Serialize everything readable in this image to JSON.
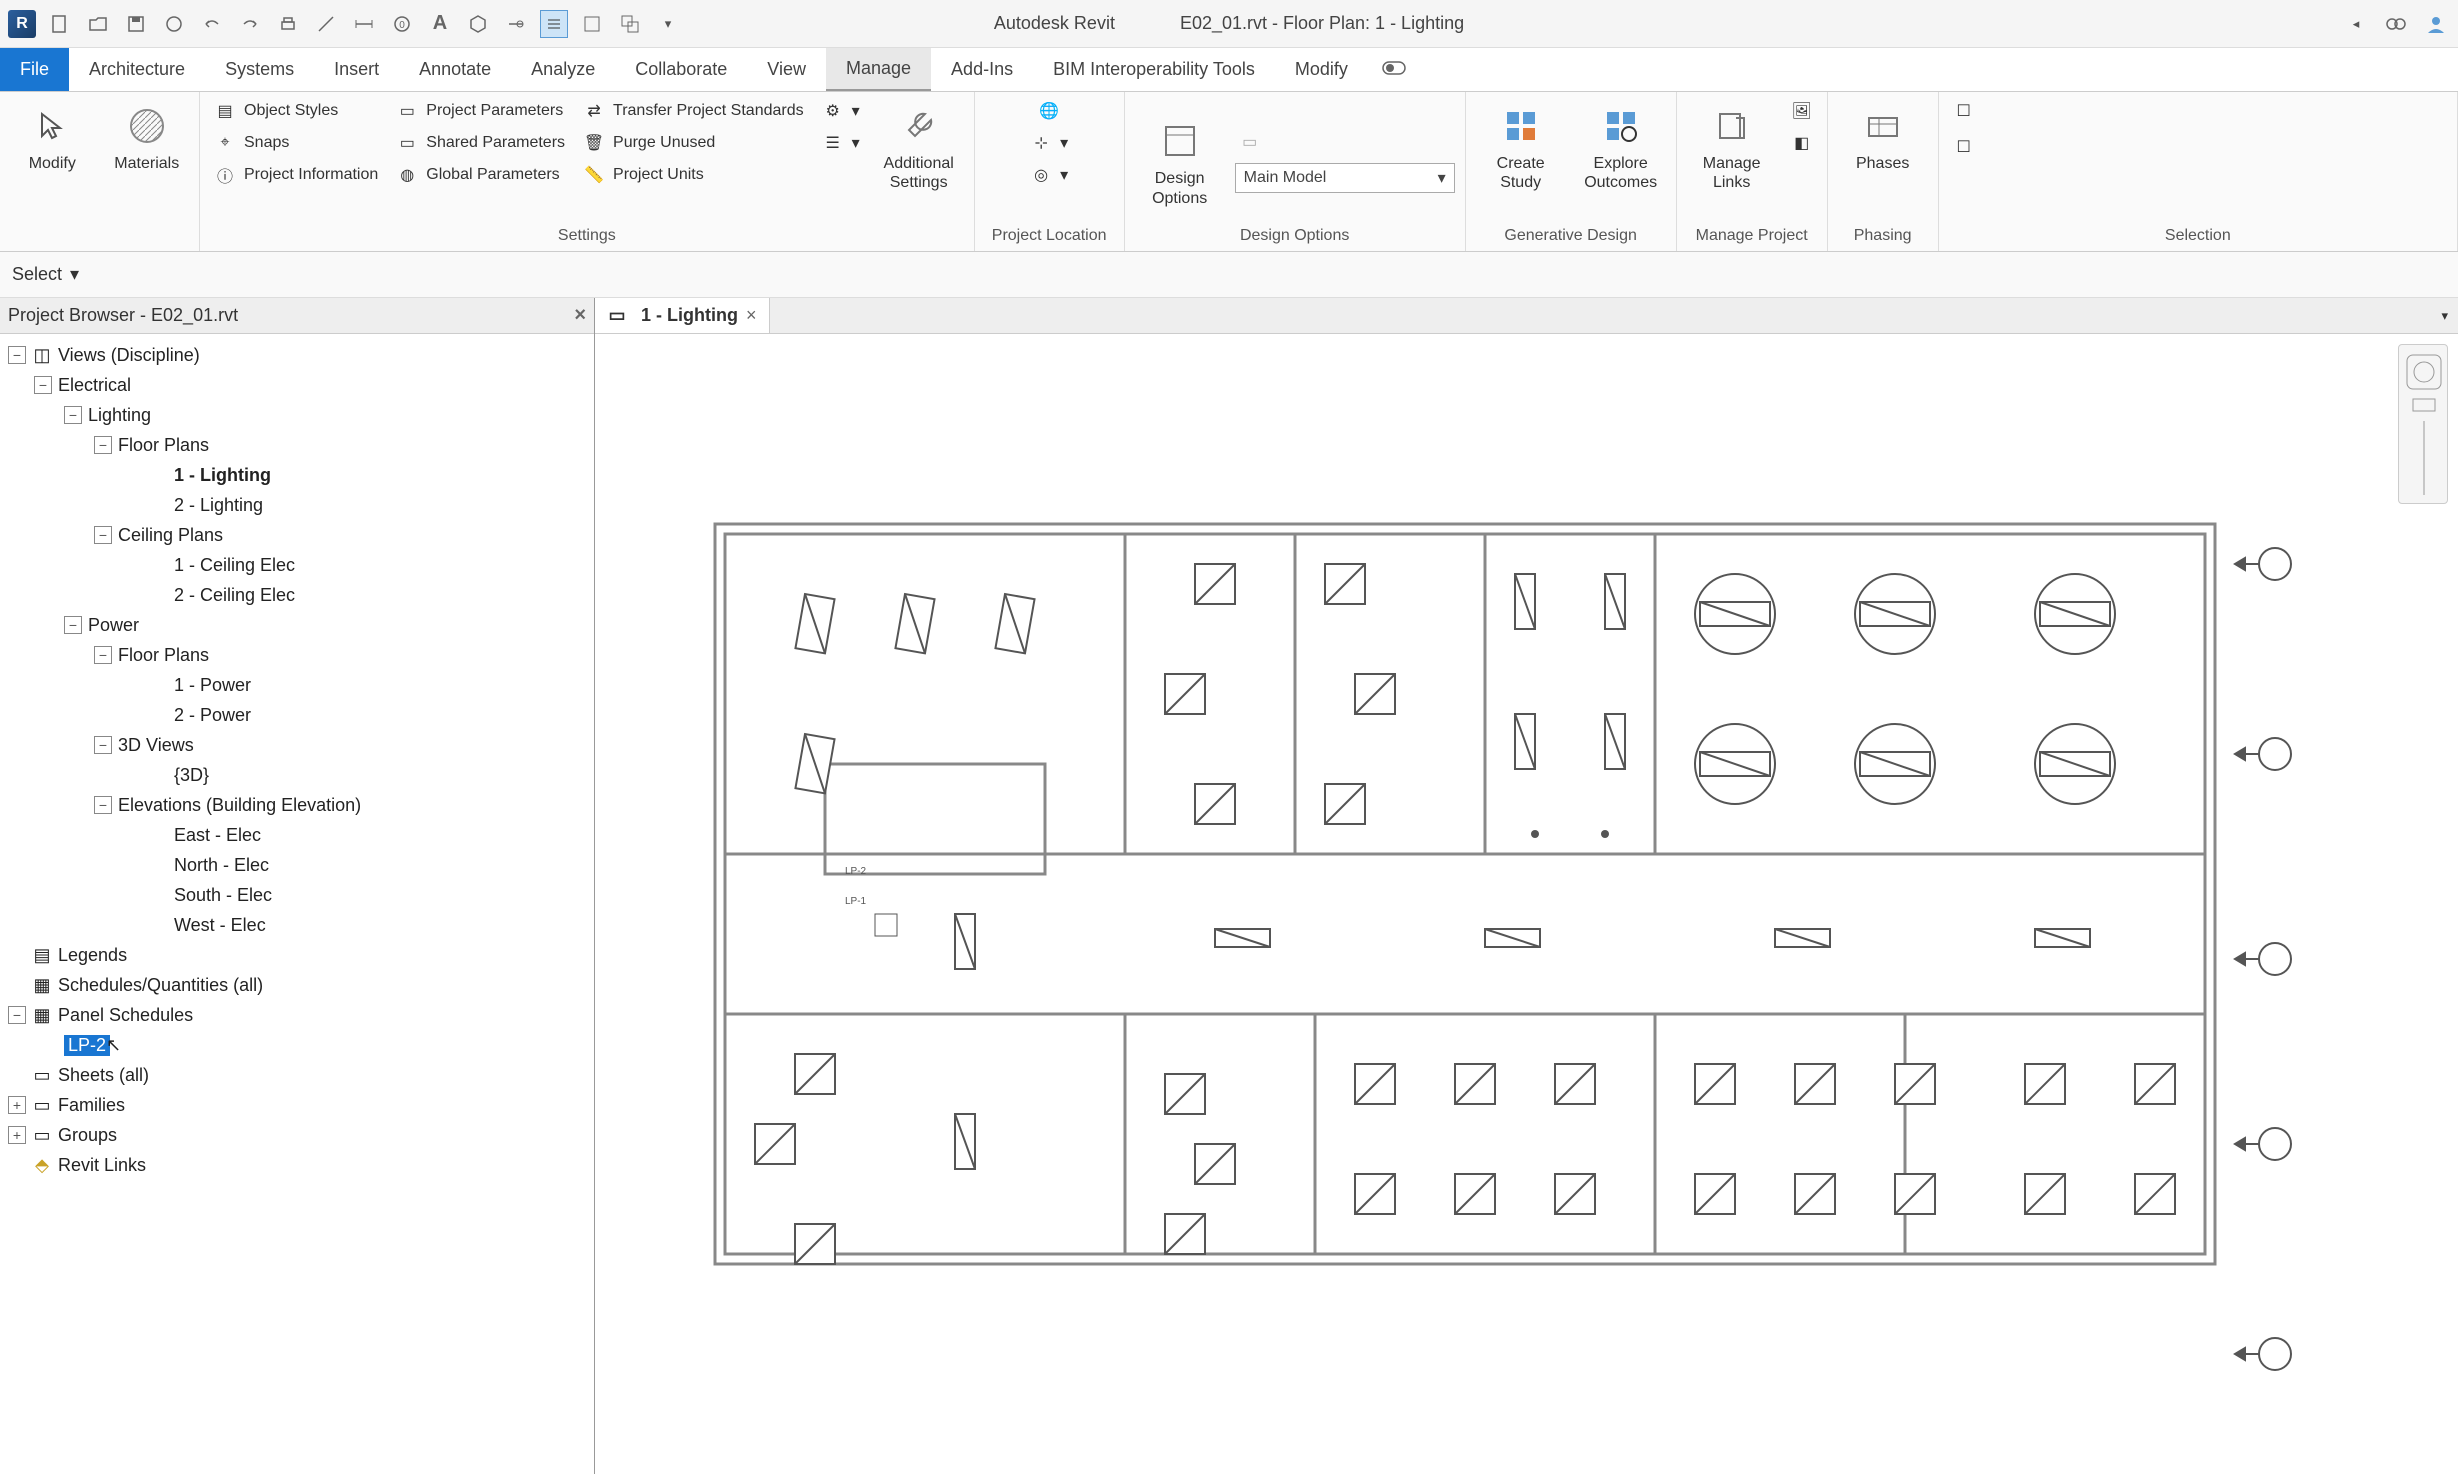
{
  "title_bar": {
    "app_name": "Autodesk Revit",
    "doc_title": "E02_01.rvt - Floor Plan: 1 - Lighting",
    "separator": " - "
  },
  "ribbon_tabs": {
    "file": "File",
    "architecture": "Architecture",
    "systems": "Systems",
    "insert": "Insert",
    "annotate": "Annotate",
    "analyze": "Analyze",
    "collaborate": "Collaborate",
    "view": "View",
    "manage": "Manage",
    "addins": "Add-Ins",
    "bim": "BIM Interoperability Tools",
    "modify": "Modify"
  },
  "ribbon": {
    "select_panel": {
      "select": "Select",
      "modify": "Modify",
      "materials": "Materials"
    },
    "settings_panel": {
      "label": "Settings",
      "object_styles": "Object  Styles",
      "snaps": "Snaps",
      "project_information": "Project  Information",
      "project_parameters": "Project  Parameters",
      "shared_parameters": "Shared  Parameters",
      "global_parameters": "Global  Parameters",
      "transfer_project_standards": "Transfer  Project Standards",
      "purge_unused": "Purge  Unused",
      "project_units": "Project  Units",
      "additional_settings": "Additional\nSettings"
    },
    "project_location_panel": {
      "label": "Project Location"
    },
    "design_options_panel": {
      "label": "Design Options",
      "design_options": "Design\nOptions",
      "combo_value": "Main Model"
    },
    "generative_design_panel": {
      "label": "Generative Design",
      "create_study": "Create\nStudy",
      "explore_outcomes": "Explore\nOutcomes"
    },
    "manage_project_panel": {
      "label": "Manage Project",
      "manage_links": "Manage\nLinks"
    },
    "phasing_panel": {
      "label": "Phasing",
      "phases": "Phases"
    },
    "selection_panel": {
      "label": "Selection"
    }
  },
  "project_browser": {
    "title": "Project Browser - E02_01.rvt",
    "views_root": "Views (Discipline)",
    "electrical": "Electrical",
    "lighting": "Lighting",
    "floor_plans": "Floor Plans",
    "fp_1_lighting": "1 - Lighting",
    "fp_2_lighting": "2 - Lighting",
    "ceiling_plans": "Ceiling Plans",
    "cp_1": "1 - Ceiling Elec",
    "cp_2": "2 - Ceiling Elec",
    "power": "Power",
    "fp_1_power": "1 - Power",
    "fp_2_power": "2 - Power",
    "views_3d": "3D Views",
    "view_3d": "{3D}",
    "elevations": "Elevations (Building Elevation)",
    "east": "East - Elec",
    "north": "North - Elec",
    "south": "South - Elec",
    "west": "West - Elec",
    "legends": "Legends",
    "schedules": "Schedules/Quantities (all)",
    "panel_schedules": "Panel Schedules",
    "lp2": "LP-2",
    "sheets": "Sheets (all)",
    "families": "Families",
    "groups": "Groups",
    "revit_links": "Revit Links"
  },
  "view_tab": {
    "name": "1 - Lighting"
  }
}
